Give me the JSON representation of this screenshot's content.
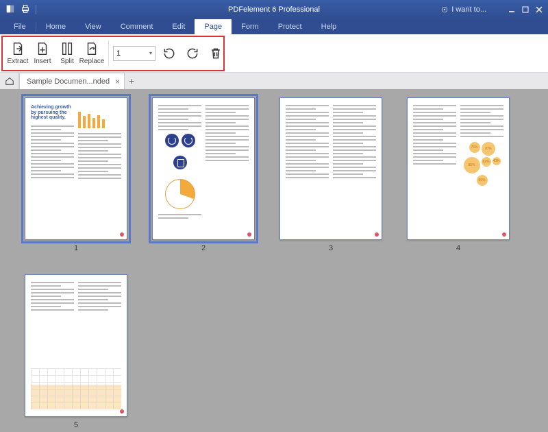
{
  "app": {
    "title": "PDFelement 6 Professional",
    "iwant": "I want to..."
  },
  "menu": {
    "items": [
      "File",
      "Home",
      "View",
      "Comment",
      "Edit",
      "Page",
      "Form",
      "Protect",
      "Help"
    ],
    "active_index": 5
  },
  "toolbar": {
    "extract": "Extract",
    "insert": "Insert",
    "split": "Split",
    "replace": "Replace",
    "page_value": "1"
  },
  "tabs": {
    "doc_name": "Sample Documen...nded"
  },
  "thumbs": {
    "labels": [
      "1",
      "2",
      "3",
      "4",
      "5"
    ],
    "selected": [
      0,
      1
    ],
    "page1_heading": "Achieving growth by pursuing the highest quality.",
    "bubble_vals": [
      "76%",
      "70%",
      "85%",
      "62%",
      "40%",
      "55%"
    ]
  }
}
